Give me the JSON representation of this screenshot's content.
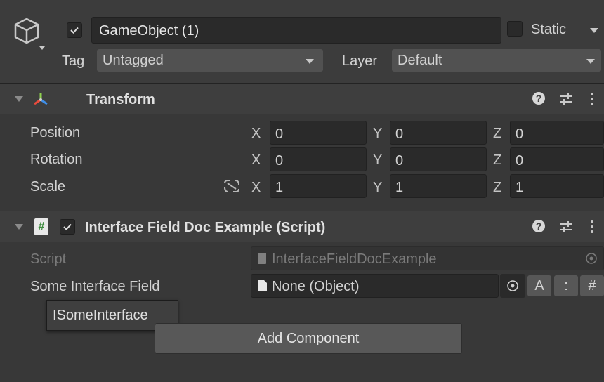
{
  "gameobject": {
    "name": "GameObject (1)",
    "static_label": "Static",
    "tag_label": "Tag",
    "tag_value": "Untagged",
    "layer_label": "Layer",
    "layer_value": "Default"
  },
  "transform": {
    "title": "Transform",
    "rows": [
      {
        "label": "Position",
        "x": "0",
        "y": "0",
        "z": "0"
      },
      {
        "label": "Rotation",
        "x": "0",
        "y": "0",
        "z": "0"
      },
      {
        "label": "Scale",
        "x": "1",
        "y": "1",
        "z": "1"
      }
    ],
    "axis_x": "X",
    "axis_y": "Y",
    "axis_z": "Z"
  },
  "script_component": {
    "title": "Interface Field Doc Example (Script)",
    "script_label": "Script",
    "script_value": "InterfaceFieldDocExample",
    "field_label": "Some Interface Field",
    "field_value": "None (Object)",
    "btn_a": "A",
    "btn_colon": ":",
    "btn_hash": "#",
    "tooltip": "ISomeInterface"
  },
  "add_component_label": "Add Component",
  "colors": {
    "background": "#383838",
    "header": "#3e3e3e",
    "field": "#2a2a2a",
    "button": "#575757",
    "text": "#d2d2d2"
  }
}
